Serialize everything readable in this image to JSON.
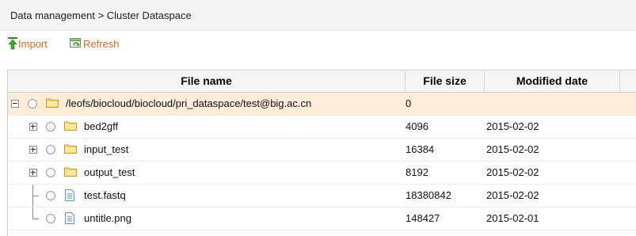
{
  "breadcrumb": "Data management > Cluster Dataspace",
  "toolbar": {
    "import_label": "Import",
    "refresh_label": "Refresh",
    "accent_color": "#e06a1e"
  },
  "table": {
    "columns": [
      "File name",
      "File size",
      "Modified date"
    ],
    "rows": [
      {
        "name": "/leofs/biocloud/biocloud/pri_dataspace/test@big.ac.cn",
        "size": "0",
        "date": "",
        "type": "folder",
        "level": 0,
        "expander": "collapse"
      },
      {
        "name": "bed2gff",
        "size": "4096",
        "date": "2015-02-02",
        "type": "folder",
        "level": 1,
        "expander": "expand"
      },
      {
        "name": "input_test",
        "size": "16384",
        "date": "2015-02-02",
        "type": "folder",
        "level": 1,
        "expander": "expand"
      },
      {
        "name": "output_test",
        "size": "8192",
        "date": "2015-02-02",
        "type": "folder",
        "level": 1,
        "expander": "expand"
      },
      {
        "name": "test.fastq",
        "size": "18380842",
        "date": "2015-02-02",
        "type": "file",
        "level": 1,
        "expander": "tee"
      },
      {
        "name": "untitle.png",
        "size": "148427",
        "date": "2015-02-01",
        "type": "file",
        "level": 1,
        "expander": "elbow"
      }
    ],
    "root_row_color": "#fcecd8"
  },
  "icons": {
    "import": "import-icon",
    "refresh": "refresh-icon",
    "folder": "folder-icon",
    "file": "file-icon"
  }
}
